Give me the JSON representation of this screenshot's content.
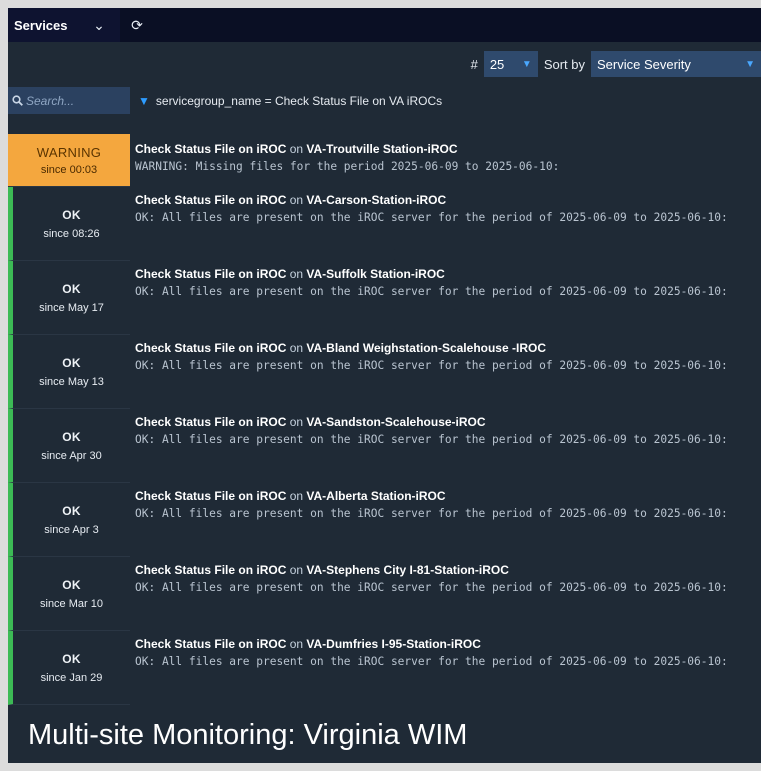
{
  "topbar": {
    "tab_label": "Services",
    "chevron_glyph": "⌄",
    "refresh_glyph": "⟳"
  },
  "controls": {
    "per_page_symbol": "#",
    "per_page_value": "25",
    "sort_label": "Sort by",
    "sort_value": "Service Severity"
  },
  "search": {
    "placeholder": "Search..."
  },
  "filter": {
    "text": "servicegroup_name = Check Status File on VA iROCs"
  },
  "colors": {
    "ok": "#3cba55",
    "warning": "#f4a73e",
    "accent": "#2d9cff"
  },
  "services": [
    {
      "status": "WARNING",
      "since": "since 00:03",
      "service": "Check Status File on iROC",
      "on": "on",
      "host": "VA-Troutville Station-iROC",
      "message": "WARNING: Missing files for the period 2025-06-09 to 2025-06-10:"
    },
    {
      "status": "OK",
      "since": "since 08:26",
      "service": "Check Status File on iROC",
      "on": "on",
      "host": "VA-Carson-Station-iROC",
      "message": "OK: All files are present on the iROC server for the period of 2025-06-09 to 2025-06-10:"
    },
    {
      "status": "OK",
      "since": "since May 17",
      "service": "Check Status File on iROC",
      "on": "on",
      "host": "VA-Suffolk Station-iROC",
      "message": "OK: All files are present on the iROC server for the period of 2025-06-09 to 2025-06-10:"
    },
    {
      "status": "OK",
      "since": "since May 13",
      "service": "Check Status File on iROC",
      "on": "on",
      "host": "VA-Bland Weighstation-Scalehouse -IROC",
      "message": "OK: All files are present on the iROC server for the period of 2025-06-09 to 2025-06-10:"
    },
    {
      "status": "OK",
      "since": "since Apr 30",
      "service": "Check Status File on iROC",
      "on": "on",
      "host": "VA-Sandston-Scalehouse-iROC",
      "message": "OK: All files are present on the iROC server for the period of 2025-06-09 to 2025-06-10:"
    },
    {
      "status": "OK",
      "since": "since Apr 3",
      "service": "Check Status File on iROC",
      "on": "on",
      "host": "VA-Alberta Station-iROC",
      "message": "OK: All files are present on the iROC server for the period of 2025-06-09 to 2025-06-10:"
    },
    {
      "status": "OK",
      "since": "since Mar 10",
      "service": "Check Status File on iROC",
      "on": "on",
      "host": "VA-Stephens City I-81-Station-iROC",
      "message": "OK: All files are present on the iROC server for the period of 2025-06-09 to 2025-06-10:"
    },
    {
      "status": "OK",
      "since": "since Jan 29",
      "service": "Check Status File on iROC",
      "on": "on",
      "host": "VA-Dumfries I-95-Station-iROC",
      "message": "OK: All files are present on the iROC server for the period of 2025-06-09 to 2025-06-10:"
    }
  ],
  "caption": "Multi-site Monitoring: Virginia WIM"
}
